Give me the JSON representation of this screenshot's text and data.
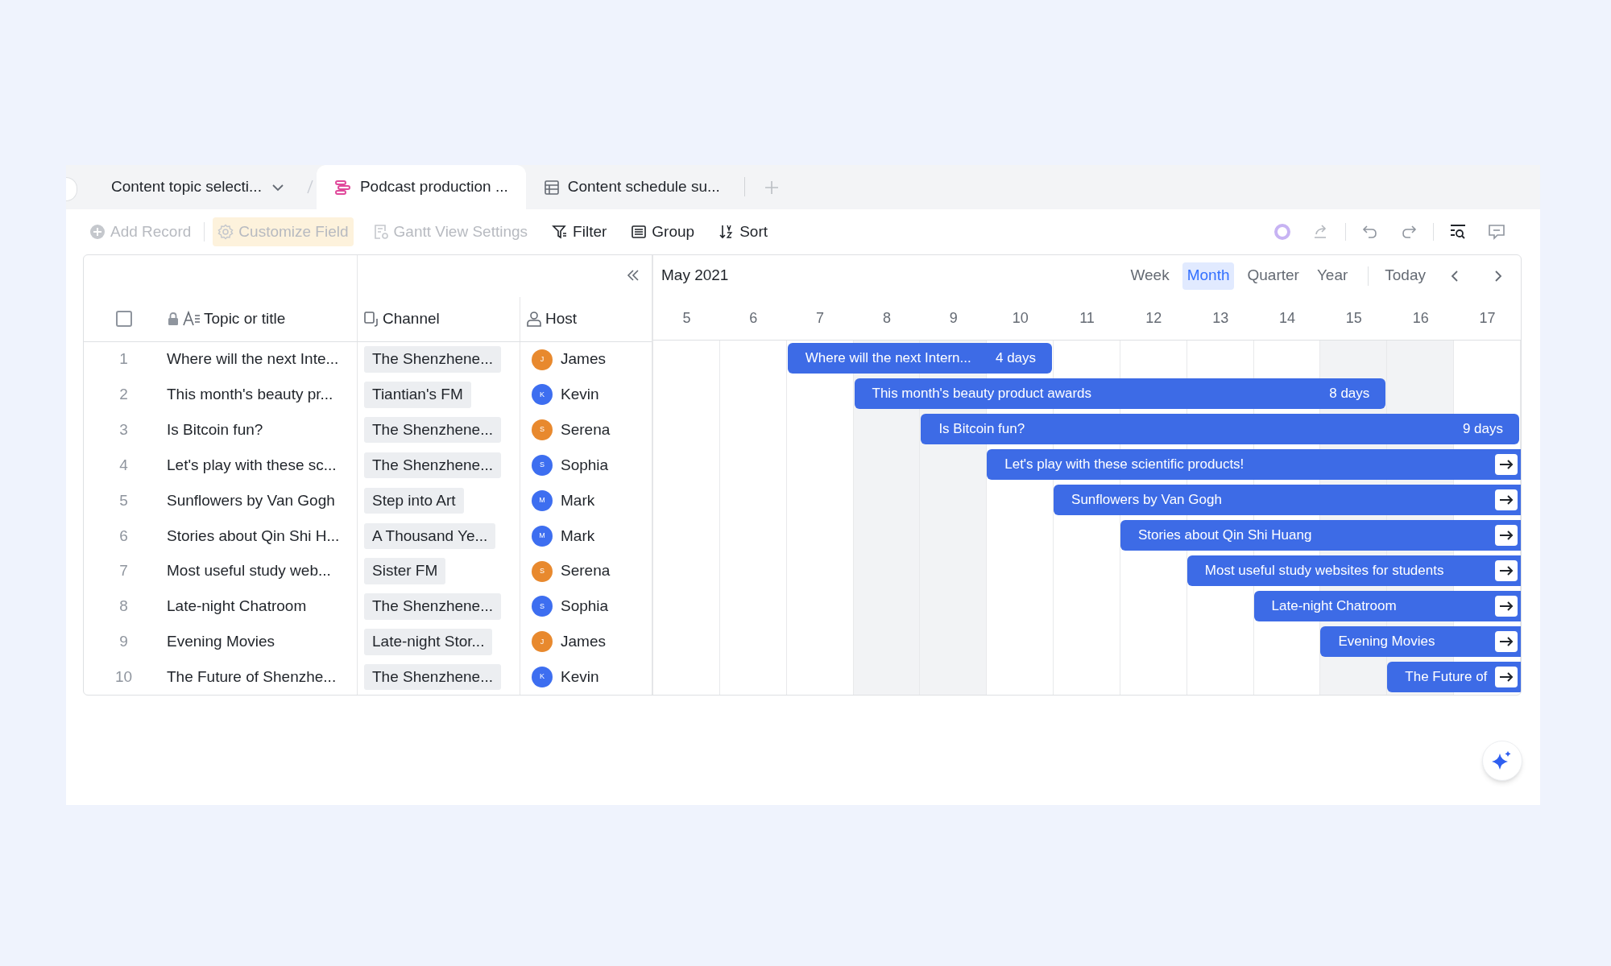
{
  "tabs": [
    {
      "label": "Content topic selecti...",
      "kind": "folder",
      "selected": false
    },
    {
      "label": "Podcast production ...",
      "kind": "gantt",
      "selected": true
    },
    {
      "label": "Content schedule su...",
      "kind": "table",
      "selected": false
    }
  ],
  "toolbar": [
    {
      "label": "Add Record",
      "kind": "add",
      "disabled": true,
      "highlighted": false
    },
    {
      "label": "Customize Field",
      "kind": "gear",
      "disabled": true,
      "highlighted": true
    },
    {
      "label": "Gantt View Settings",
      "kind": "settings",
      "disabled": true,
      "highlighted": false
    },
    {
      "label": "Filter",
      "kind": "filter",
      "disabled": false,
      "highlighted": false
    },
    {
      "label": "Group",
      "kind": "group",
      "disabled": false,
      "highlighted": false
    },
    {
      "label": "Sort",
      "kind": "sort",
      "disabled": false,
      "highlighted": false
    }
  ],
  "grid": {
    "select_all_checked": false,
    "columns": [
      {
        "label": "Topic or title",
        "kind": "text"
      },
      {
        "label": "Channel",
        "kind": "channel"
      },
      {
        "label": "Host",
        "kind": "person"
      }
    ],
    "rows": [
      {
        "number": "1",
        "topic": "Where will the next Inte...",
        "channel": "The Shenzhene...",
        "host": {
          "name": "James",
          "initial": "J",
          "color": "#e8892e"
        }
      },
      {
        "number": "2",
        "topic": "This month's beauty pr...",
        "channel": "Tiantian's FM",
        "host": {
          "name": "Kevin",
          "initial": "K",
          "color": "#3d6ef0"
        }
      },
      {
        "number": "3",
        "topic": "Is Bitcoin fun?",
        "channel": "The Shenzhene...",
        "host": {
          "name": "Serena",
          "initial": "S",
          "color": "#e8892e"
        }
      },
      {
        "number": "4",
        "topic": "Let's play with these sc...",
        "channel": "The Shenzhene...",
        "host": {
          "name": "Sophia",
          "initial": "S",
          "color": "#3d6ef0"
        }
      },
      {
        "number": "5",
        "topic": "Sunflowers by Van Gogh",
        "channel": "Step into Art",
        "host": {
          "name": "Mark",
          "initial": "M",
          "color": "#3d6ef0"
        }
      },
      {
        "number": "6",
        "topic": "Stories about Qin Shi H...",
        "channel": "A Thousand Ye...",
        "host": {
          "name": "Mark",
          "initial": "M",
          "color": "#3d6ef0"
        }
      },
      {
        "number": "7",
        "topic": "Most useful study web...",
        "channel": "Sister FM",
        "host": {
          "name": "Serena",
          "initial": "S",
          "color": "#e8892e"
        }
      },
      {
        "number": "8",
        "topic": "Late-night Chatroom",
        "channel": "The Shenzhene...",
        "host": {
          "name": "Sophia",
          "initial": "S",
          "color": "#3d6ef0"
        }
      },
      {
        "number": "9",
        "topic": "Evening Movies",
        "channel": "Late-night Stor...",
        "host": {
          "name": "James",
          "initial": "J",
          "color": "#e8892e"
        }
      },
      {
        "number": "10",
        "topic": "The Future of Shenzhe...",
        "channel": "The Shenzhene...",
        "host": {
          "name": "Kevin",
          "initial": "K",
          "color": "#3d6ef0"
        }
      }
    ]
  },
  "gantt": {
    "period": "May 2021",
    "scales": [
      {
        "label": "Week",
        "selected": false
      },
      {
        "label": "Month",
        "selected": true
      },
      {
        "label": "Quarter",
        "selected": false
      },
      {
        "label": "Year",
        "selected": false
      }
    ],
    "today": "Today",
    "days": [
      {
        "label": "5",
        "weekend": false
      },
      {
        "label": "6",
        "weekend": false
      },
      {
        "label": "7",
        "weekend": false
      },
      {
        "label": "8",
        "weekend": true
      },
      {
        "label": "9",
        "weekend": true
      },
      {
        "label": "10",
        "weekend": false
      },
      {
        "label": "11",
        "weekend": false
      },
      {
        "label": "12",
        "weekend": false
      },
      {
        "label": "13",
        "weekend": false
      },
      {
        "label": "14",
        "weekend": false
      },
      {
        "label": "15",
        "weekend": true
      },
      {
        "label": "16",
        "weekend": true
      },
      {
        "label": "17",
        "weekend": false
      }
    ],
    "bars": [
      {
        "title": "Where will the next Intern...",
        "duration": "4 days",
        "continues": false
      },
      {
        "title": "This month's beauty product awards",
        "duration": "8 days",
        "continues": false
      },
      {
        "title": "Is Bitcoin fun?",
        "duration": "9 days",
        "continues": false
      },
      {
        "title": "Let's play with these scientific products!",
        "continues": true
      },
      {
        "title": "Sunflowers by Van Gogh",
        "continues": true
      },
      {
        "title": "Stories about Qin Shi Huang",
        "continues": true
      },
      {
        "title": "Most useful study websites for students",
        "continues": true
      },
      {
        "title": "Late-night Chatroom",
        "continues": true
      },
      {
        "title": "Evening Movies",
        "continues": true
      },
      {
        "title": "The Future of",
        "continues": true
      }
    ]
  }
}
